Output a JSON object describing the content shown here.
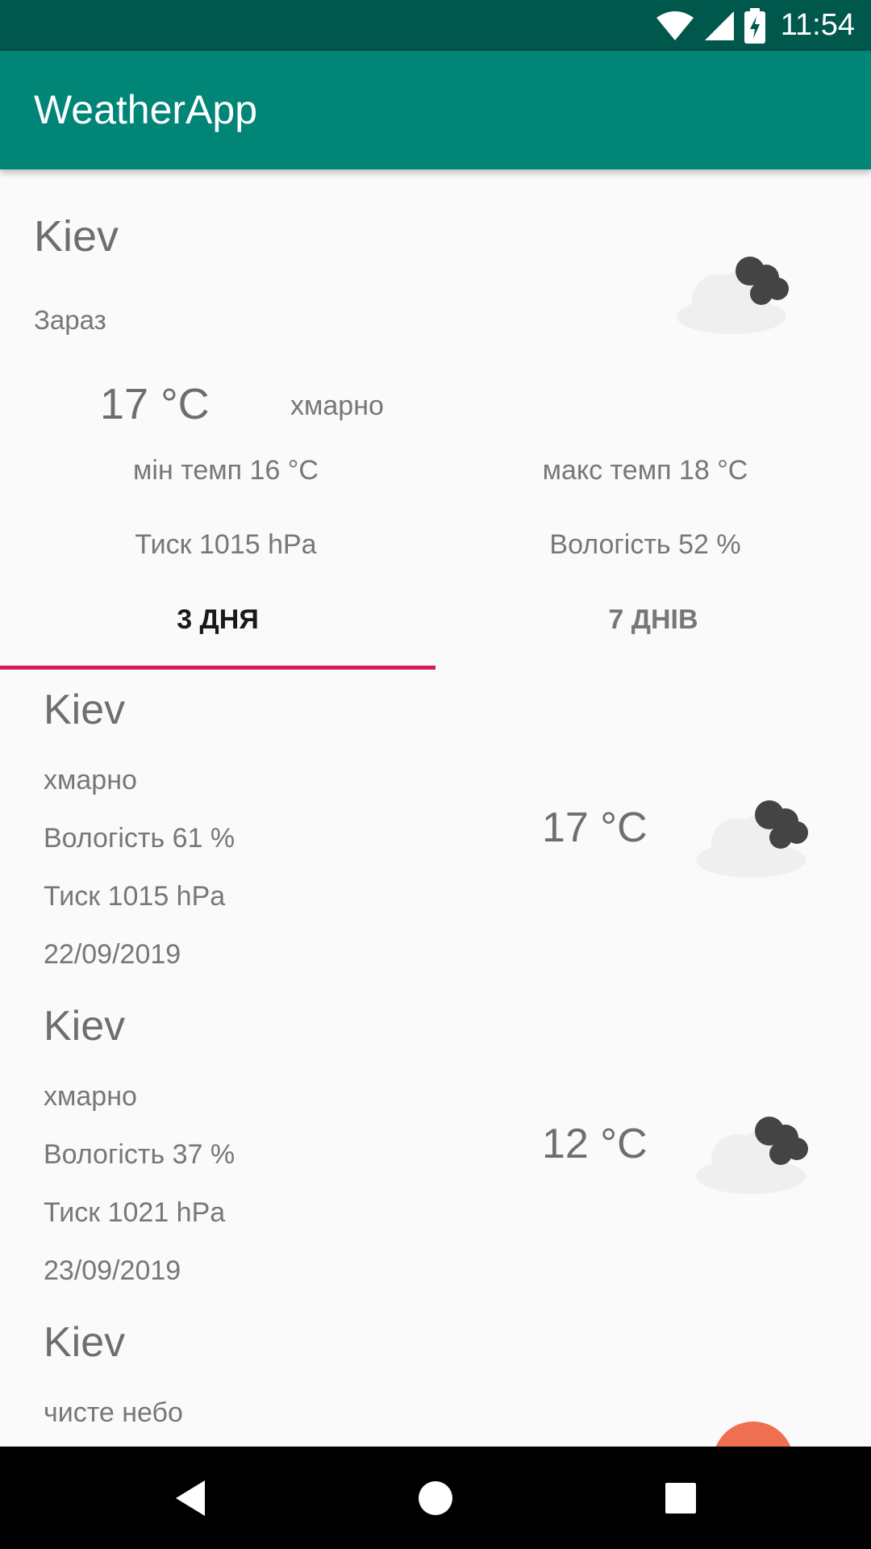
{
  "status_bar": {
    "time": "11:54",
    "icons": [
      "wifi-icon",
      "signal-icon",
      "battery-charging-icon"
    ]
  },
  "app_bar": {
    "title": "WeatherApp"
  },
  "current": {
    "city": "Kiev",
    "label": "Зараз",
    "temperature": "17 °C",
    "description": "хмарно",
    "min_temp": "мін темп 16 °C",
    "max_temp": "макс темп 18 °C",
    "pressure": "Тиск 1015 hPa",
    "humidity": "Вологість 52 %",
    "icon": "cloudy-icon"
  },
  "tabs": [
    {
      "label": "3 ДНЯ",
      "selected": true
    },
    {
      "label": "7 ДНІВ",
      "selected": false
    }
  ],
  "forecast": [
    {
      "city": "Kiev",
      "description": "хмарно",
      "humidity": "Вологість 61 %",
      "pressure": "Тиск 1015 hPa",
      "date": "22/09/2019",
      "temperature": "17 °C",
      "icon": "cloudy-icon"
    },
    {
      "city": "Kiev",
      "description": "хмарно",
      "humidity": "Вологість 37 %",
      "pressure": "Тиск 1021 hPa",
      "date": "23/09/2019",
      "temperature": "12 °C",
      "icon": "cloudy-icon"
    },
    {
      "city": "Kiev",
      "description": "чисте небо",
      "humidity": "",
      "pressure": "",
      "date": "",
      "temperature": "",
      "icon": "sun-icon"
    }
  ],
  "colors": {
    "status_bar": "#00574b",
    "app_bar": "#008577",
    "accent": "#d81b60",
    "sun": "#ef6f50"
  }
}
